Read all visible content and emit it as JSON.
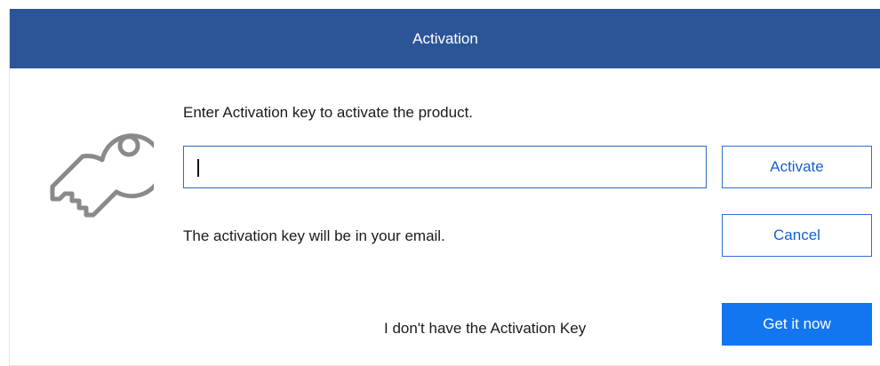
{
  "dialog": {
    "title": "Activation",
    "prompt": "Enter Activation key to activate the product.",
    "key_input": {
      "value": "",
      "placeholder": ""
    },
    "activate_label": "Activate",
    "cancel_label": "Cancel",
    "hint": "The activation key will be in your email.",
    "no_key_label": "I don't have the Activation Key",
    "get_it_now_label": "Get it now",
    "icon": "key-icon"
  },
  "colors": {
    "titlebar": "#2b5597",
    "primary_button": "#1276f0",
    "outline_button_text": "#1560d6",
    "icon": "#8a8a8a"
  }
}
